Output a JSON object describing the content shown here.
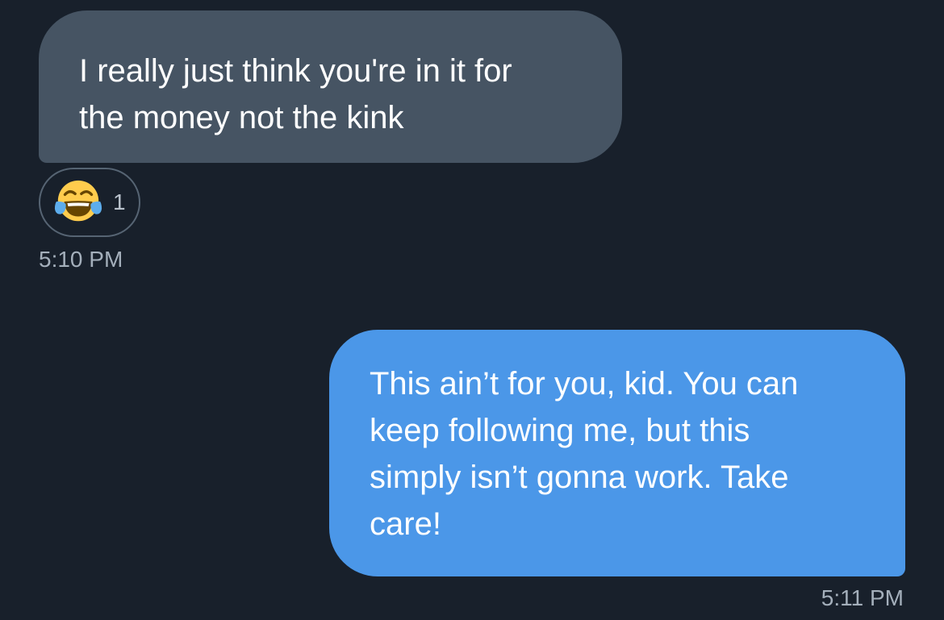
{
  "conversation": {
    "incoming_message": {
      "lines": [
        "I really just think you're in it for",
        "the money not the kink"
      ],
      "time": "5:10 PM",
      "reaction": {
        "emoji_icon": "face-with-tears-of-joy-icon",
        "count": "1"
      }
    },
    "outgoing_message": {
      "lines": [
        "This ain’t for you, kid. You can",
        "keep following me, but this",
        "simply isn’t gonna work. Take",
        "care!"
      ],
      "time": "5:11 PM"
    }
  },
  "colors": {
    "background": "#18202b",
    "incoming_bubble": "#465463",
    "outgoing_bubble": "#4b97e8",
    "timestamp_text": "#a4afbb"
  }
}
